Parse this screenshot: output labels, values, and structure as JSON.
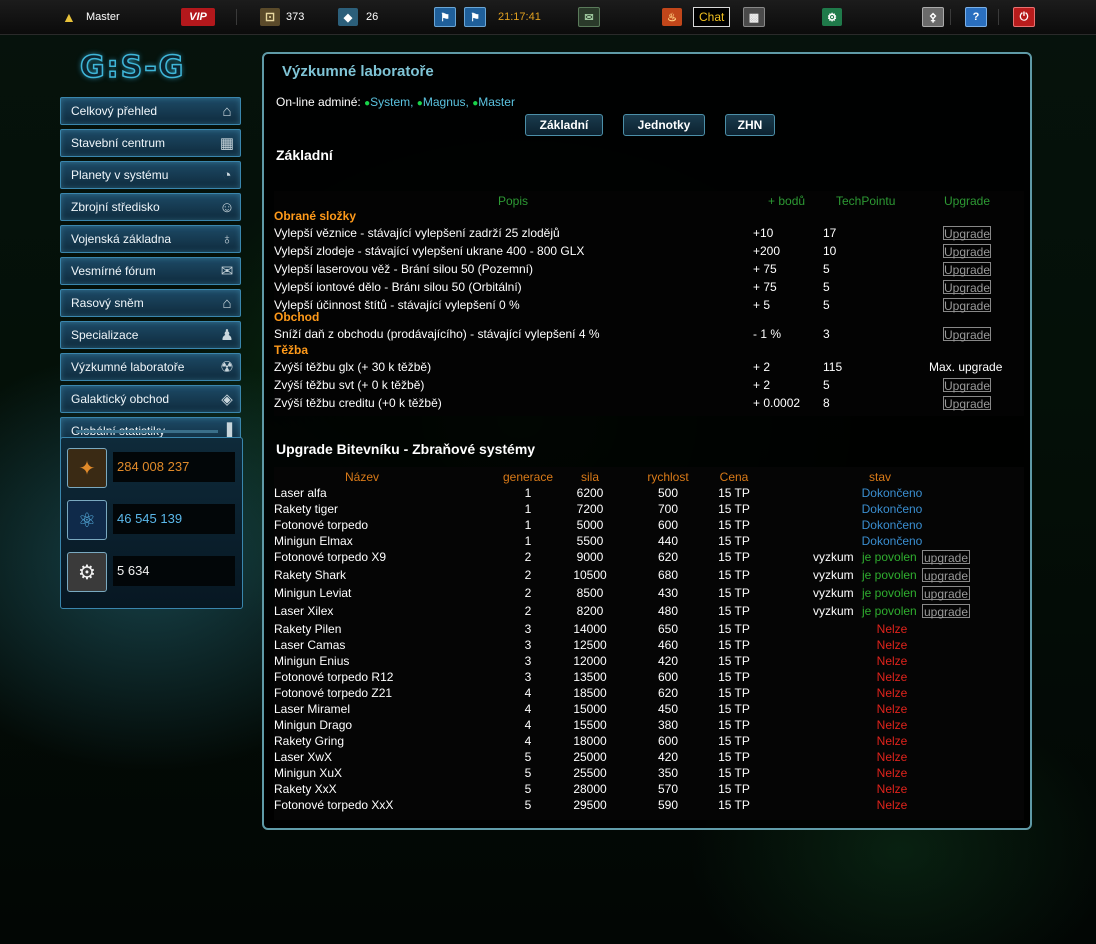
{
  "topbar": {
    "username": "Master",
    "vip": "VIP",
    "stat1": "373",
    "stat2": "26",
    "time": "21:17:41",
    "chat": "Chat",
    "help": "?"
  },
  "logo": "G:S-G",
  "menu": [
    {
      "label": "Celkový přehled",
      "icon": "home-icon"
    },
    {
      "label": "Stavební centrum",
      "icon": "building-icon"
    },
    {
      "label": "Planety v systému",
      "icon": "planet-icon"
    },
    {
      "label": "Zbrojní středisko",
      "icon": "soldier-icon"
    },
    {
      "label": "Vojenská základna",
      "icon": "satellite-icon"
    },
    {
      "label": "Vesmírné fórum",
      "icon": "chat-bubbles-icon"
    },
    {
      "label": "Rasový sněm",
      "icon": "temple-icon"
    },
    {
      "label": "Specializace",
      "icon": "users-icon"
    },
    {
      "label": "Výzkumné laboratoře",
      "icon": "radiation-icon"
    },
    {
      "label": "Galaktický obchod",
      "icon": "tag-icon"
    },
    {
      "label": "Globální statistiky",
      "icon": "bar-chart-icon"
    }
  ],
  "resources": [
    {
      "value": "284 008 237",
      "color": "#e08a2a",
      "icon": "glx-icon"
    },
    {
      "value": "46 545 139",
      "color": "#5bb8ea",
      "icon": "svt-icon"
    },
    {
      "value": "5 634",
      "color": "#f2f2f2",
      "icon": "credit-icon"
    }
  ],
  "panel": {
    "title": "Výzkumné laboratoře",
    "admins_label": "On-line adminé:",
    "admins": [
      "System,",
      "Magnus,",
      "Master"
    ],
    "tabs": [
      "Základní",
      "Jednotky",
      "ZHN"
    ]
  },
  "basic": {
    "title": "Základní",
    "headers": [
      "Popis",
      "+ bodů",
      "TechPointu",
      "Upgrade"
    ],
    "upgrade_label": "Upgrade",
    "max_label": "Max. upgrade",
    "groups": [
      {
        "category": "Obrané složky",
        "rows": [
          {
            "desc": "Vylepší věznice - stávající vylepšení zadrží 25 zlodějů",
            "points": "+10",
            "tp": "17",
            "action": "upgrade"
          },
          {
            "desc": "Vylepší zlodeje - stávající vylepšení ukrane 400 - 800 GLX",
            "points": "+200",
            "tp": "10",
            "action": "upgrade"
          },
          {
            "desc": "Vylepší laserovou věž - Brání silou 50 (Pozemní)",
            "points": "+ 75",
            "tp": "5",
            "action": "upgrade"
          },
          {
            "desc": "Vylepší iontové dělo - Bránı silou 50 (Orbitální)",
            "points": "+ 75",
            "tp": "5",
            "action": "upgrade"
          },
          {
            "desc": "Vylepší účinnost štítů - stávající vylepšení 0 %",
            "points": "+ 5",
            "tp": "5",
            "action": "upgrade"
          }
        ]
      },
      {
        "category": "Obchod",
        "rows": [
          {
            "desc": "Sníží daň z obchodu (prodávajícího) - stávající vylepšení 4 %",
            "points": "- 1 %",
            "tp": "3",
            "action": "upgrade"
          }
        ]
      },
      {
        "category": "Těžba",
        "rows": [
          {
            "desc": "Zvýší těžbu glx (+ 30 k těžbě)",
            "points": "+ 2",
            "tp": "115",
            "action": "max"
          },
          {
            "desc": "Zvýší těžbu svt (+ 0 k těžbě)",
            "points": "+ 2",
            "tp": "5",
            "action": "upgrade"
          },
          {
            "desc": "Zvýší těžbu creditu (+0 k těžbě)",
            "points": "+ 0.0002",
            "tp": "8",
            "action": "upgrade"
          }
        ]
      }
    ]
  },
  "weapons": {
    "title": "Upgrade Bitevníku - Zbraňové systémy",
    "headers": [
      "Název",
      "generace",
      "sila",
      "rychlost",
      "Cena",
      "stav"
    ],
    "status_labels": {
      "done": "Dokončeno",
      "nelze": "Nelze",
      "vyzkum": "vyzkum",
      "povolen": "je povolen",
      "upgrade": "upgrade"
    },
    "rows": [
      {
        "name": "Laser alfa",
        "gen": "1",
        "sila": "6200",
        "speed": "500",
        "price": "15 TP",
        "status": "done"
      },
      {
        "name": "Rakety tiger",
        "gen": "1",
        "sila": "7200",
        "speed": "700",
        "price": "15 TP",
        "status": "done"
      },
      {
        "name": "Fotonové torpedo",
        "gen": "1",
        "sila": "5000",
        "speed": "600",
        "price": "15 TP",
        "status": "done"
      },
      {
        "name": "Minigun Elmax",
        "gen": "1",
        "sila": "5500",
        "speed": "440",
        "price": "15 TP",
        "status": "done"
      },
      {
        "name": "Fotonové torpedo X9",
        "gen": "2",
        "sila": "9000",
        "speed": "620",
        "price": "15 TP",
        "status": "research"
      },
      {
        "name": "Rakety Shark",
        "gen": "2",
        "sila": "10500",
        "speed": "680",
        "price": "15 TP",
        "status": "research"
      },
      {
        "name": "Minigun Leviat",
        "gen": "2",
        "sila": "8500",
        "speed": "430",
        "price": "15 TP",
        "status": "research"
      },
      {
        "name": "Laser Xilex",
        "gen": "2",
        "sila": "8200",
        "speed": "480",
        "price": "15 TP",
        "status": "research"
      },
      {
        "name": "Rakety Pilen",
        "gen": "3",
        "sila": "14000",
        "speed": "650",
        "price": "15 TP",
        "status": "nelze"
      },
      {
        "name": "Laser Camas",
        "gen": "3",
        "sila": "12500",
        "speed": "460",
        "price": "15 TP",
        "status": "nelze"
      },
      {
        "name": "Minigun Enius",
        "gen": "3",
        "sila": "12000",
        "speed": "420",
        "price": "15 TP",
        "status": "nelze"
      },
      {
        "name": "Fotonové torpedo R12",
        "gen": "3",
        "sila": "13500",
        "speed": "600",
        "price": "15 TP",
        "status": "nelze"
      },
      {
        "name": "Fotonové torpedo Z21",
        "gen": "4",
        "sila": "18500",
        "speed": "620",
        "price": "15 TP",
        "status": "nelze"
      },
      {
        "name": "Laser Miramel",
        "gen": "4",
        "sila": "15000",
        "speed": "450",
        "price": "15 TP",
        "status": "nelze"
      },
      {
        "name": "Minigun Drago",
        "gen": "4",
        "sila": "15500",
        "speed": "380",
        "price": "15 TP",
        "status": "nelze"
      },
      {
        "name": "Rakety Gring",
        "gen": "4",
        "sila": "18000",
        "speed": "600",
        "price": "15 TP",
        "status": "nelze"
      },
      {
        "name": "Laser XwX",
        "gen": "5",
        "sila": "25000",
        "speed": "420",
        "price": "15 TP",
        "status": "nelze"
      },
      {
        "name": "Minigun XuX",
        "gen": "5",
        "sila": "25500",
        "speed": "350",
        "price": "15 TP",
        "status": "nelze"
      },
      {
        "name": "Rakety XxX",
        "gen": "5",
        "sila": "28000",
        "speed": "570",
        "price": "15 TP",
        "status": "nelze"
      },
      {
        "name": "Fotonové torpedo XxX",
        "gen": "5",
        "sila": "29500",
        "speed": "590",
        "price": "15 TP",
        "status": "nelze"
      }
    ]
  }
}
